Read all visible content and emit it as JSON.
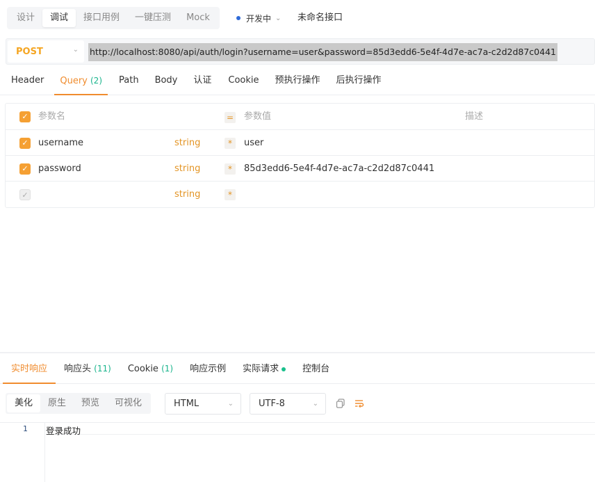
{
  "mode_tabs": [
    "设计",
    "调试",
    "接口用例",
    "一键压测",
    "Mock"
  ],
  "environment": "开发中",
  "interface_name": "未命名接口",
  "request": {
    "method": "POST",
    "url": "http://localhost:8080/api/auth/login?username=user&password=85d3edd6-5e4f-4d7e-ac7a-c2d2d87c0441"
  },
  "request_tabs": [
    {
      "label": "Header",
      "count": ""
    },
    {
      "label": "Query",
      "count": "(2)"
    },
    {
      "label": "Path",
      "count": ""
    },
    {
      "label": "Body",
      "count": ""
    },
    {
      "label": "认证",
      "count": ""
    },
    {
      "label": "Cookie",
      "count": ""
    },
    {
      "label": "预执行操作",
      "count": ""
    },
    {
      "label": "后执行操作",
      "count": ""
    }
  ],
  "params": {
    "header": {
      "name": "参数名",
      "mark": "=",
      "value": "参数值",
      "desc": "描述"
    },
    "rows": [
      {
        "name": "username",
        "type": "string",
        "required": "*",
        "value": "user"
      },
      {
        "name": "password",
        "type": "string",
        "required": "*",
        "value": "85d3edd6-5e4f-4d7e-ac7a-c2d2d87c0441"
      },
      {
        "name": "",
        "type": "string",
        "required": "*",
        "value": ""
      }
    ]
  },
  "response_tabs": [
    {
      "label": "实时响应",
      "count": ""
    },
    {
      "label": "响应头",
      "count": "(11)"
    },
    {
      "label": "Cookie",
      "count": "(1)"
    },
    {
      "label": "响应示例",
      "count": ""
    },
    {
      "label": "实际请求",
      "count": ""
    },
    {
      "label": "控制台",
      "count": ""
    }
  ],
  "format_tabs": [
    "美化",
    "原生",
    "预览",
    "可视化"
  ],
  "response_format": "HTML",
  "encoding": "UTF-8",
  "response_body": {
    "line_number": "1",
    "text": "登录成功"
  },
  "colors": {
    "accent": "#f08c2e",
    "method": "#f5a623",
    "count": "#19b48c",
    "env_dot": "#2f6bd8"
  }
}
